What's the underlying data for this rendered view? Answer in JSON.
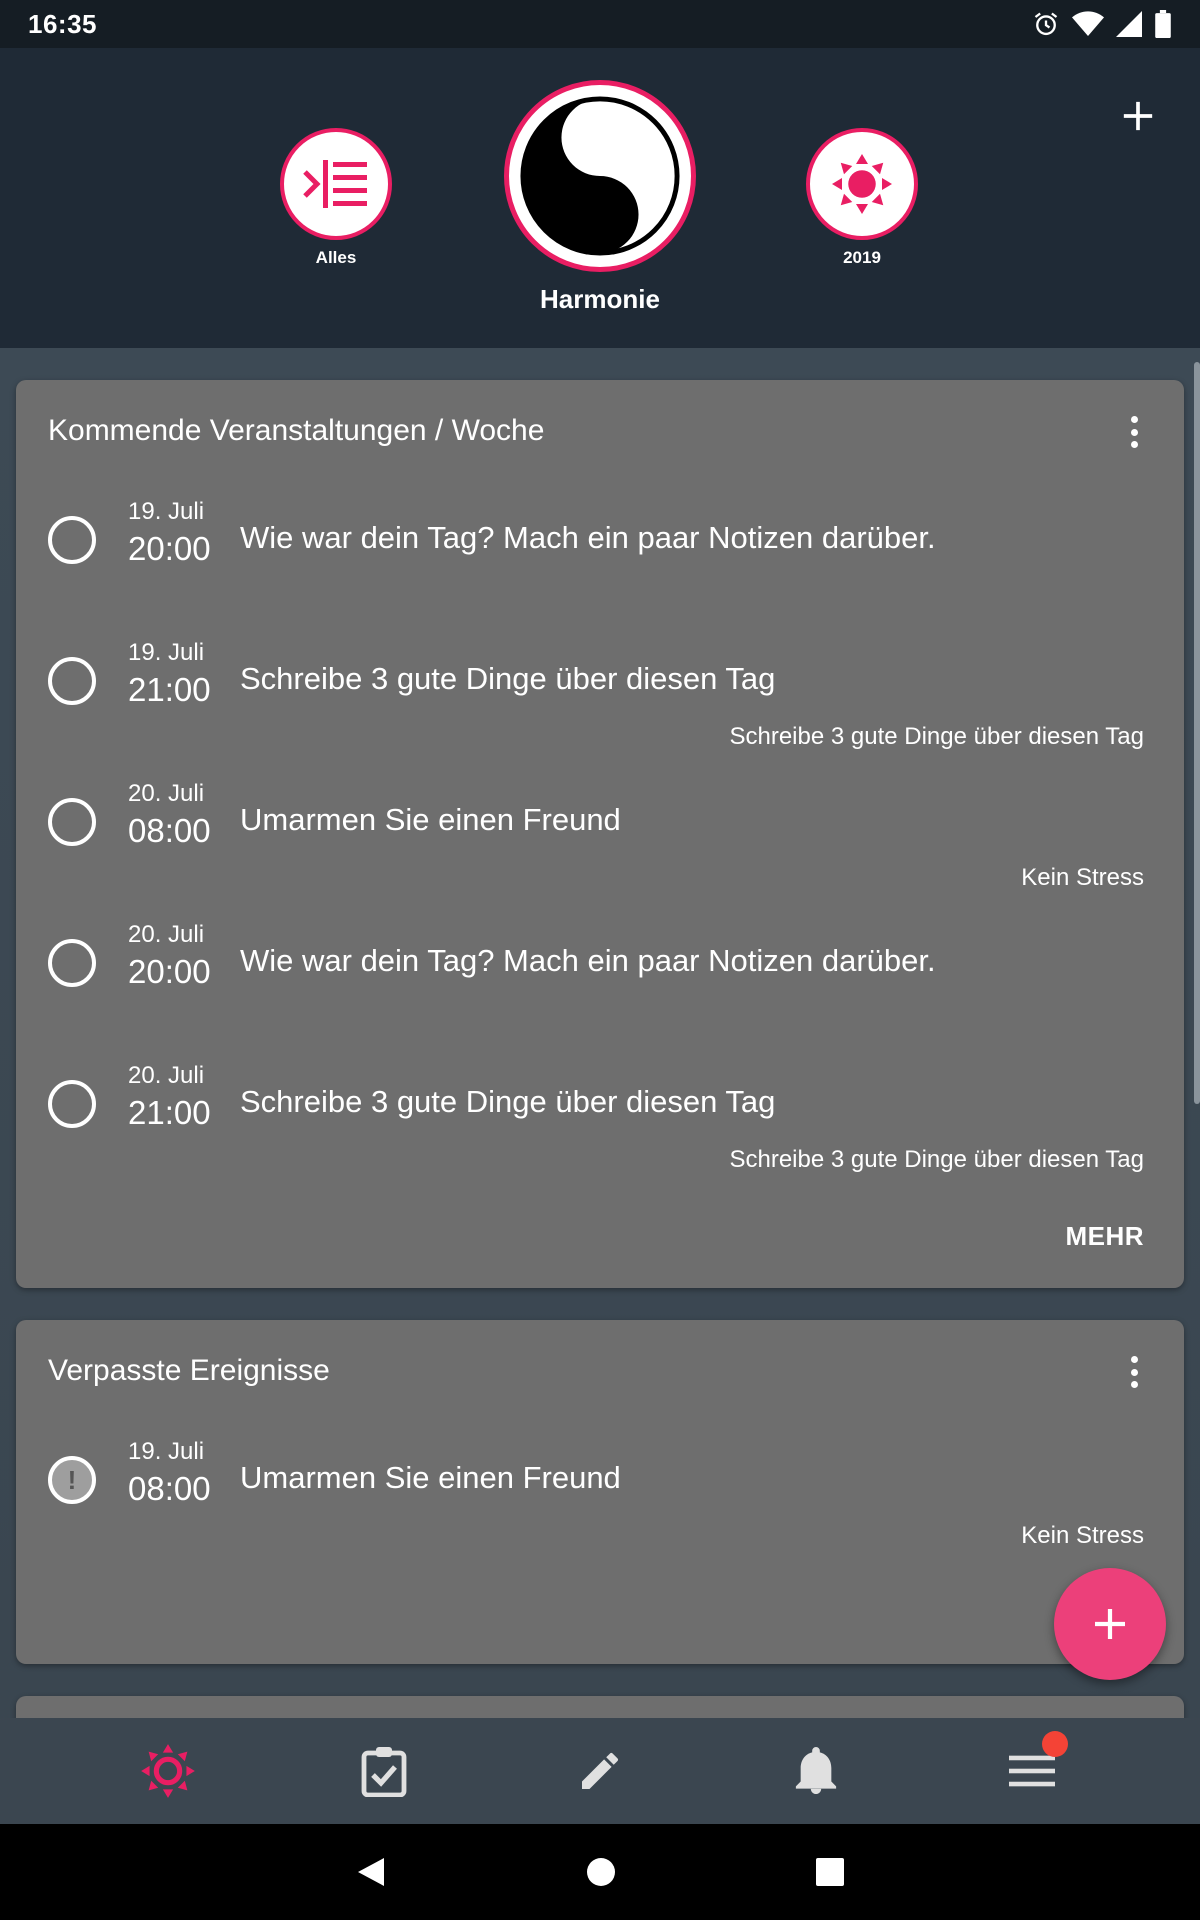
{
  "status_bar": {
    "time": "16:35",
    "icons": [
      "alarm-icon",
      "wifi-icon",
      "signal-icon",
      "battery-icon"
    ]
  },
  "header": {
    "add_icon": "plus-icon",
    "categories": [
      {
        "label": "Alles",
        "icon": "list-indent-icon"
      },
      {
        "label": "Harmonie",
        "icon": "yin-yang-icon"
      },
      {
        "label": "2019",
        "icon": "sun-icon"
      }
    ]
  },
  "cards": [
    {
      "title": "Kommende Veranstaltungen / Woche",
      "more_label": "MEHR",
      "events": [
        {
          "date": "19. Juli",
          "time": "20:00",
          "text": "Wie war dein Tag? Mach ein paar Notizen darüber.",
          "sub": ""
        },
        {
          "date": "19. Juli",
          "time": "21:00",
          "text": "Schreibe 3 gute Dinge über diesen Tag",
          "sub": "Schreibe 3 gute Dinge über diesen Tag"
        },
        {
          "date": "20. Juli",
          "time": "08:00",
          "text": "Umarmen Sie einen Freund",
          "sub": "Kein Stress"
        },
        {
          "date": "20. Juli",
          "time": "20:00",
          "text": "Wie war dein Tag? Mach ein paar Notizen darüber.",
          "sub": ""
        },
        {
          "date": "20. Juli",
          "time": "21:00",
          "text": "Schreibe 3 gute Dinge über diesen Tag",
          "sub": "Schreibe 3 gute Dinge über diesen Tag"
        }
      ]
    },
    {
      "title": "Verpasste Ereignisse",
      "events": [
        {
          "date": "19. Juli",
          "time": "08:00",
          "text": "Umarmen Sie einen Freund",
          "sub": "Kein Stress",
          "missed_mark": "!"
        }
      ]
    }
  ],
  "bottom_nav": [
    {
      "icon": "sun-icon",
      "active": true
    },
    {
      "icon": "clipboard-check-icon"
    },
    {
      "icon": "pencil-icon"
    },
    {
      "icon": "bell-icon"
    },
    {
      "icon": "menu-icon",
      "badge": true
    }
  ],
  "colors": {
    "accent": "#e91e63",
    "header_bg": "#1f2a36",
    "card_bg": "#6e6e6e",
    "fab": "#ec407a"
  }
}
